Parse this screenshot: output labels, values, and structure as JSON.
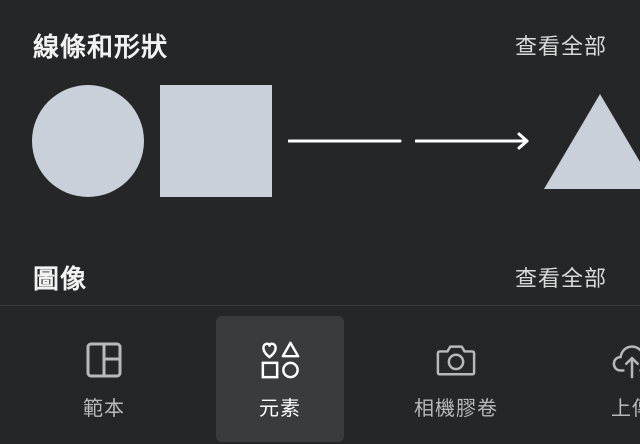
{
  "sections": [
    {
      "title": "線條和形狀",
      "see_all": "查看全部"
    },
    {
      "title": "圖像",
      "see_all": "查看全部"
    }
  ],
  "shapes": [
    {
      "name": "circle",
      "color": "#c9d0d9"
    },
    {
      "name": "square",
      "color": "#c9d0d9"
    },
    {
      "name": "line",
      "color": "#ffffff"
    },
    {
      "name": "arrow-line",
      "color": "#ffffff"
    },
    {
      "name": "triangle",
      "color": "#c9d0d9"
    }
  ],
  "nav": {
    "active_index": 1,
    "items": [
      {
        "label": "範本",
        "icon": "layout-icon"
      },
      {
        "label": "元素",
        "icon": "shapes-icon"
      },
      {
        "label": "相機膠卷",
        "icon": "camera-icon"
      },
      {
        "label": "上傳",
        "icon": "cloud-upload-icon"
      }
    ]
  },
  "colors": {
    "background": "#252627",
    "active_tab": "#3a3b3d",
    "shape_fill": "#c9d0d9",
    "inactive_label": "#b8b9bc"
  }
}
